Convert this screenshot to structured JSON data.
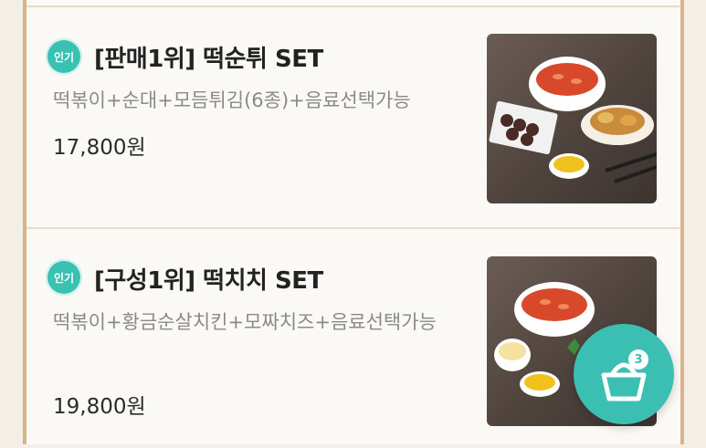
{
  "menu": {
    "items": [
      {
        "badge": "인기",
        "title": "[판매1위] 떡순튀 SET",
        "description": "떡볶이+순대+모듬튀김(6종)+음료선택가능",
        "price": "17,800원",
        "image": "tteokbokki-set-photo"
      },
      {
        "badge": "인기",
        "title": "[구성1위] 떡치치 SET",
        "description": "떡볶이+황금순살치킨+모짜치즈+음료선택가능",
        "price": "19,800원",
        "image": "tteokbokki-chicken-set-photo"
      }
    ]
  },
  "cart": {
    "icon": "basket-icon",
    "count": "3"
  },
  "colors": {
    "accent": "#3bbfb2",
    "frame": "#d9b48a",
    "panel": "#fbf9f5"
  }
}
